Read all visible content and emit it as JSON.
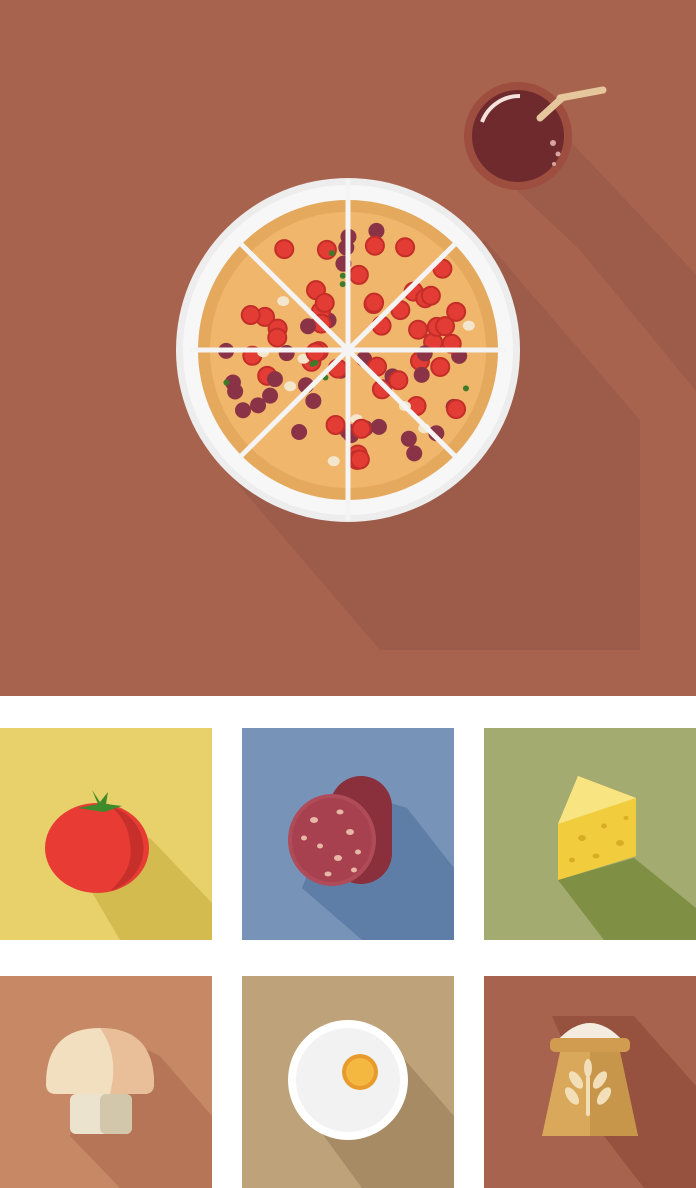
{
  "hero": {
    "background": "#a8634f",
    "main_icon": "pizza-icon",
    "accent_icon": "drink-cup-icon"
  },
  "tiles": [
    {
      "icon": "tomato-icon",
      "background": "#e8d16a"
    },
    {
      "icon": "salami-icon",
      "background": "#7793b7"
    },
    {
      "icon": "cheese-icon",
      "background": "#a3ab70"
    },
    {
      "icon": "mushroom-icon",
      "background": "#c78866"
    },
    {
      "icon": "egg-icon",
      "background": "#bea27a"
    },
    {
      "icon": "flour-sack-icon",
      "background": "#a8634f"
    }
  ]
}
